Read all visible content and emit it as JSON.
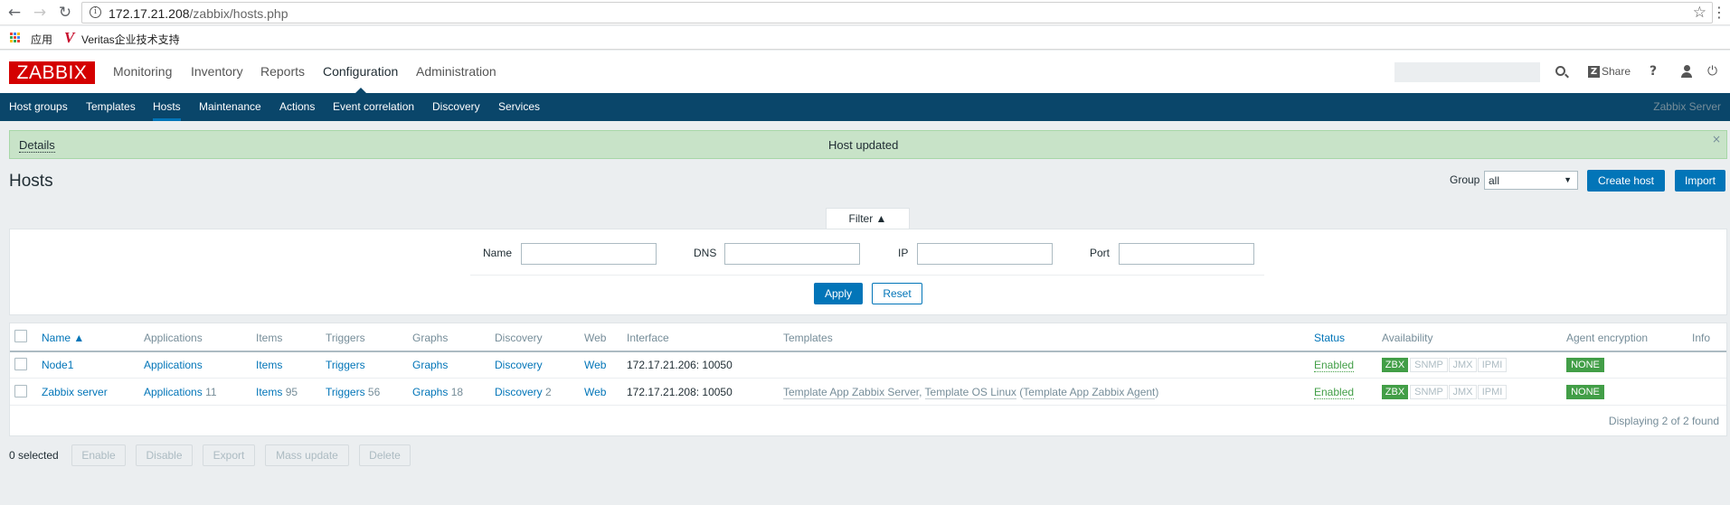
{
  "browser": {
    "url_host": "172.17.21.208",
    "url_path": "/zabbix/hosts.php",
    "bookmarks": [
      "应用",
      "Veritas企业技术支持"
    ]
  },
  "header": {
    "logo": "ZABBIX",
    "menu": [
      "Monitoring",
      "Inventory",
      "Reports",
      "Configuration",
      "Administration"
    ],
    "selected_menu": "Configuration",
    "share_label": "Share",
    "search_placeholder": ""
  },
  "subnav": {
    "items": [
      "Host groups",
      "Templates",
      "Hosts",
      "Maintenance",
      "Actions",
      "Event correlation",
      "Discovery",
      "Services"
    ],
    "active": "Hosts",
    "server": "Zabbix Server"
  },
  "message": {
    "details": "Details",
    "text": "Host updated",
    "close": "×"
  },
  "page": {
    "title": "Hosts",
    "group_label": "Group",
    "group_value": "all",
    "create_host": "Create host",
    "import": "Import"
  },
  "filter": {
    "tab_label": "Filter ▲",
    "fields": [
      "Name",
      "DNS",
      "IP",
      "Port"
    ],
    "apply": "Apply",
    "reset": "Reset"
  },
  "table": {
    "headers": [
      "Name ▲",
      "Applications",
      "Items",
      "Triggers",
      "Graphs",
      "Discovery",
      "Web",
      "Interface",
      "Templates",
      "Status",
      "Availability",
      "Agent encryption",
      "Info"
    ],
    "rows": [
      {
        "name": "Node1",
        "applications": "Applications",
        "applications_count": "",
        "items": "Items",
        "items_count": "",
        "triggers": "Triggers",
        "triggers_count": "",
        "graphs": "Graphs",
        "graphs_count": "",
        "discovery": "Discovery",
        "discovery_count": "",
        "web": "Web",
        "interface": "172.17.21.206: 10050",
        "templates": "",
        "status": "Enabled",
        "availability": [
          "ZBX",
          "SNMP",
          "JMX",
          "IPMI"
        ],
        "encryption": "NONE"
      },
      {
        "name": "Zabbix server",
        "applications": "Applications",
        "applications_count": "11",
        "items": "Items",
        "items_count": "95",
        "triggers": "Triggers",
        "triggers_count": "56",
        "graphs": "Graphs",
        "graphs_count": "18",
        "discovery": "Discovery",
        "discovery_count": "2",
        "web": "Web",
        "interface": "172.17.21.208: 10050",
        "templates": "Template App Zabbix Server, Template OS Linux (Template App Zabbix Agent)",
        "template_1": "Template App Zabbix Server",
        "template_2": "Template OS Linux",
        "template_3": "Template App Zabbix Agent",
        "status": "Enabled",
        "availability": [
          "ZBX",
          "SNMP",
          "JMX",
          "IPMI"
        ],
        "encryption": "NONE"
      }
    ],
    "footer": "Displaying 2 of 2 found"
  },
  "actions": {
    "selected": "0 selected",
    "buttons": [
      "Enable",
      "Disable",
      "Export",
      "Mass update",
      "Delete"
    ]
  },
  "colors": {
    "brand_red": "#d40000",
    "nav_blue": "#0a466a",
    "link_blue": "#0275b8",
    "status_green": "#429e47",
    "message_bg": "#c8e3c8"
  }
}
